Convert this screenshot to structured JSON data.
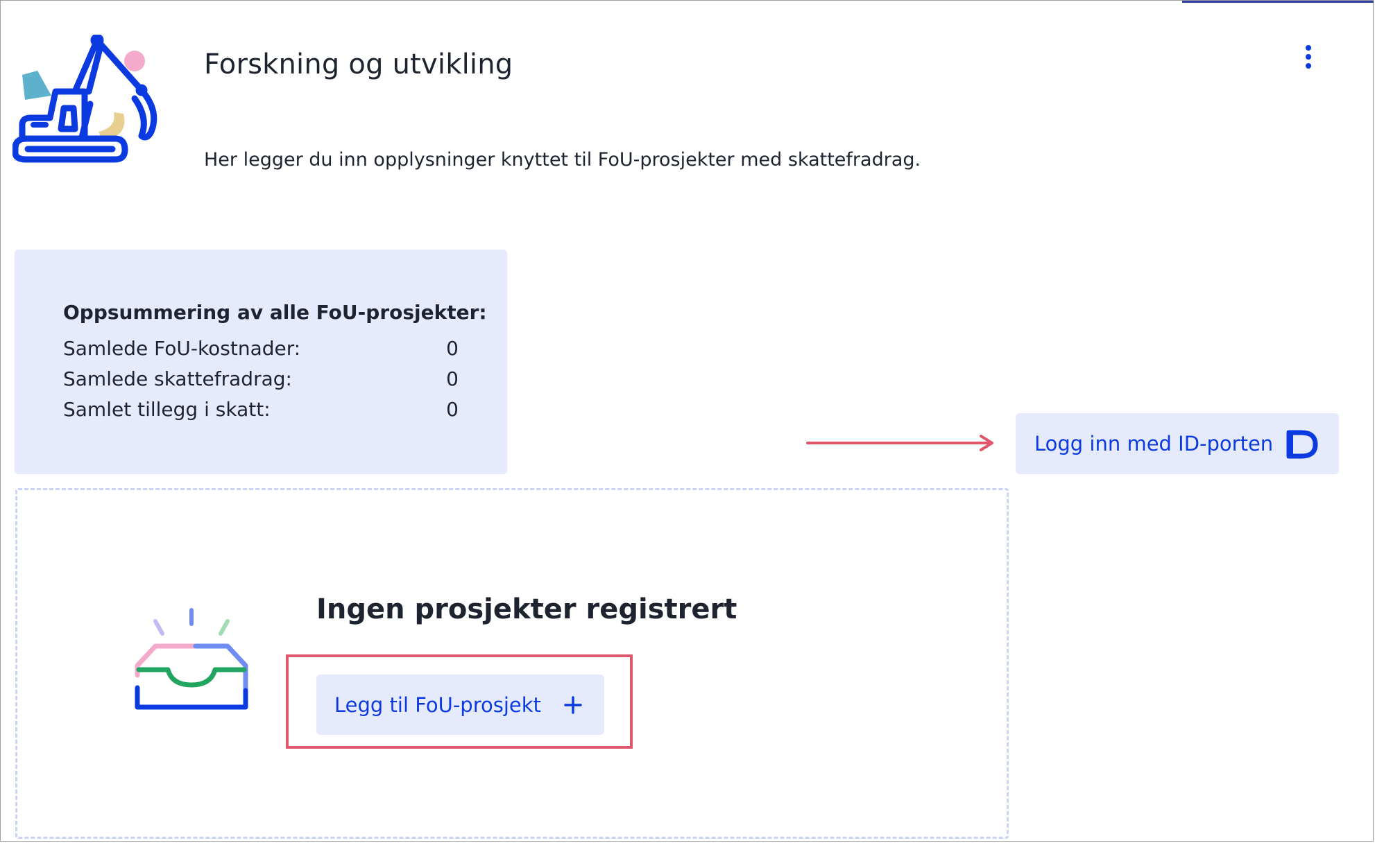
{
  "header": {
    "title": "Forskning og utvikling",
    "intro": "Her legger du inn opplysninger knyttet til FoU-prosjekter med skattefradrag.",
    "menu_icon": "more-vertical-icon",
    "illustration": "excavator-icon"
  },
  "summary": {
    "heading": "Oppsummering av alle FoU-prosjekter:",
    "rows": [
      {
        "label": "Samlede FoU-kostnader:",
        "value": "0"
      },
      {
        "label": "Samlede skattefradrag:",
        "value": "0"
      },
      {
        "label": "Samlet tillegg i skatt:",
        "value": "0"
      }
    ]
  },
  "login": {
    "label": "Logg inn med ID-porten",
    "icon": "idporten-icon"
  },
  "empty_state": {
    "heading": "Ingen prosjekter registrert",
    "illustration": "empty-inbox-icon",
    "add_button_label": "Legg til FoU-prosjekt",
    "add_icon": "plus-icon"
  },
  "colors": {
    "accent_blue": "#0b3be0",
    "card_background": "#e6eafd",
    "annotation_red": "#e0566b",
    "text_dark": "#1e2330"
  }
}
